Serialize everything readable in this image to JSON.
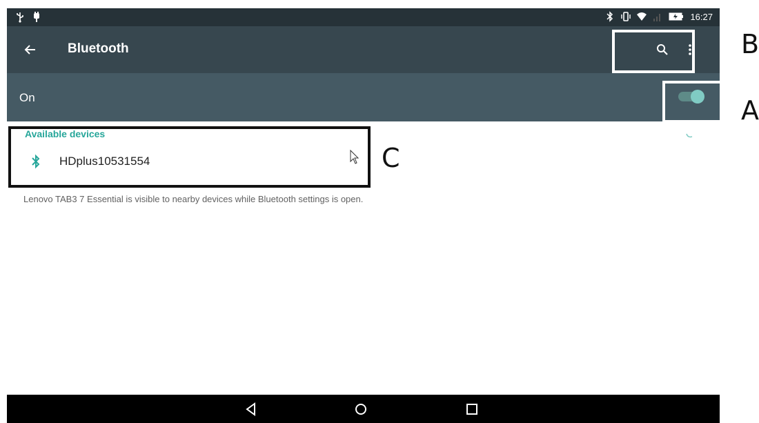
{
  "status_bar": {
    "time": "16:27",
    "icons_left": [
      "usb-icon",
      "notification-icon"
    ],
    "icons_right": [
      "bluetooth-status-icon",
      "vibrate-icon",
      "wifi-icon",
      "signal-icon",
      "battery-icon"
    ]
  },
  "toolbar": {
    "title": "Bluetooth",
    "back_icon": "arrow-left-icon",
    "search_icon": "search-icon",
    "overflow_icon": "more-vert-icon"
  },
  "switch_bar": {
    "label": "On",
    "toggle_state": "on"
  },
  "devices": {
    "section_title": "Available devices",
    "items": [
      {
        "name": "HDplus10531554",
        "icon": "bluetooth-icon"
      }
    ],
    "visibility_note": "Lenovo TAB3 7 Essential is visible to nearby devices while Bluetooth settings is open."
  },
  "nav_bar": {
    "buttons": [
      "back",
      "home",
      "recents"
    ]
  },
  "annotations": {
    "labels": [
      "A",
      "B",
      "C"
    ]
  },
  "colors": {
    "status_bar": "#263238",
    "toolbar": "#37474f",
    "switch_bar": "#455a64",
    "accent": "#26a69a",
    "toggle_thumb": "#80cbc4"
  }
}
